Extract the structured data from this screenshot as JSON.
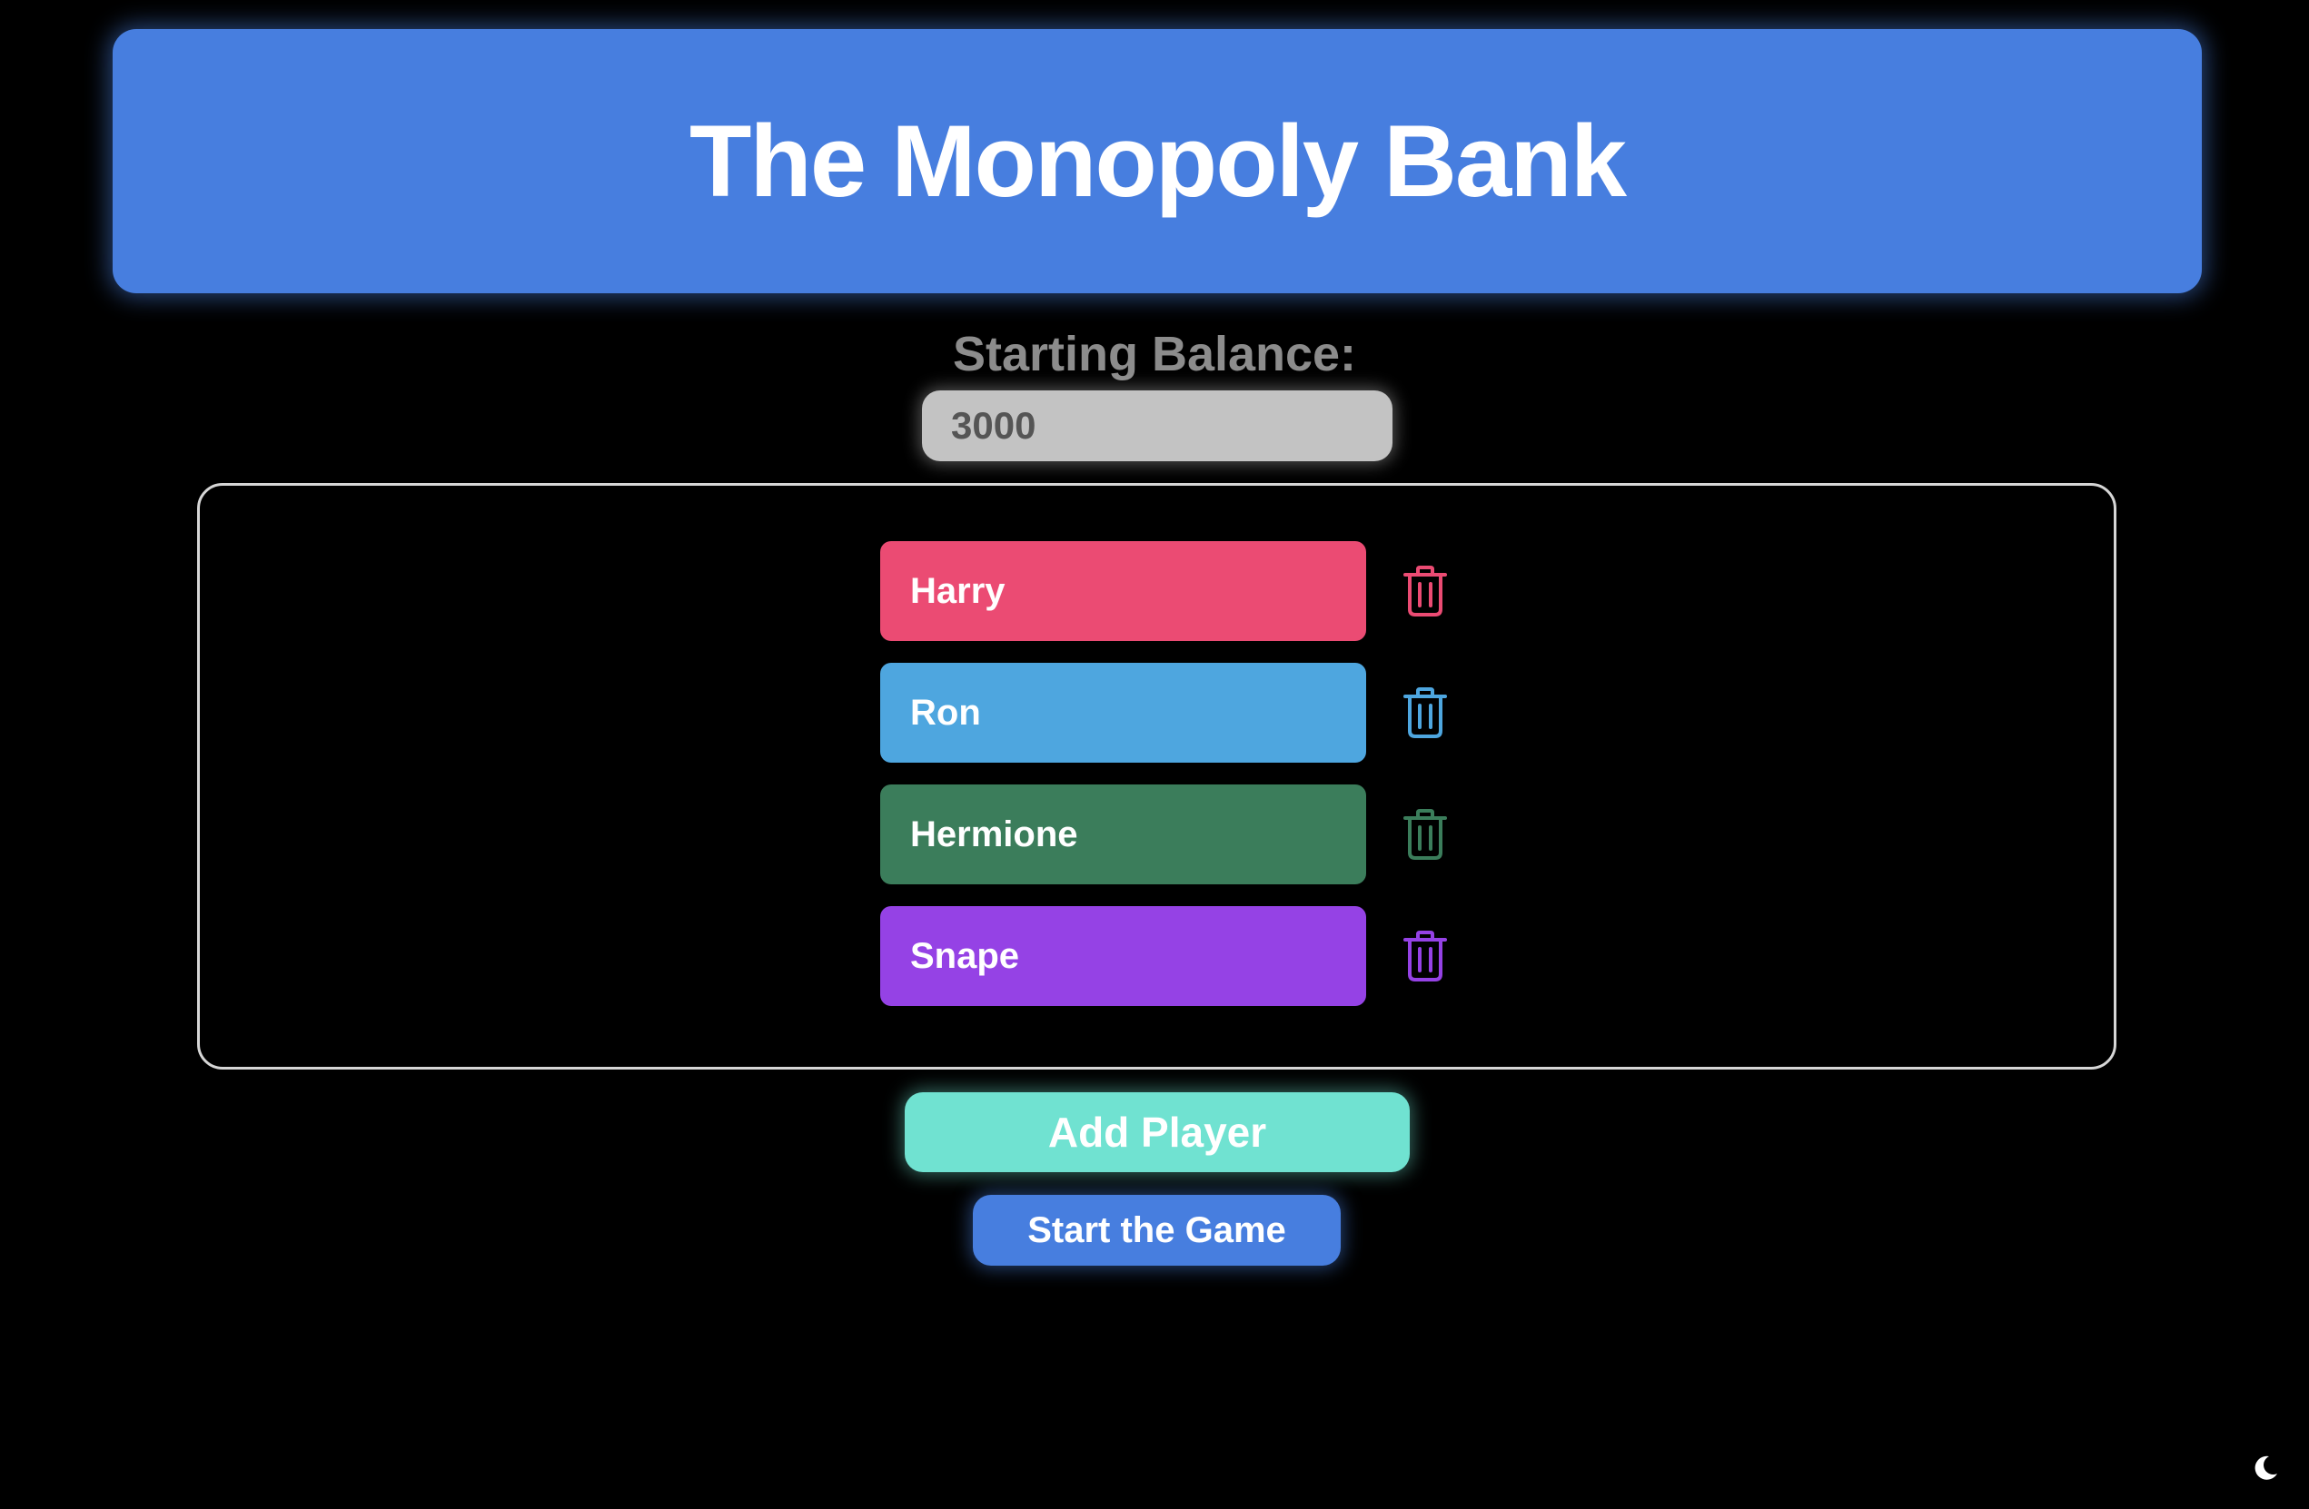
{
  "header": {
    "title": "The Monopoly Bank",
    "color": "#477edf"
  },
  "balance": {
    "label": "Starting Balance:",
    "value": "3000"
  },
  "players": [
    {
      "name": "Harry",
      "color": "#eb4b73",
      "delete_icon": "trash-icon"
    },
    {
      "name": "Ron",
      "color": "#4ea6df",
      "delete_icon": "trash-icon"
    },
    {
      "name": "Hermione",
      "color": "#3b7d5b",
      "delete_icon": "trash-icon"
    },
    {
      "name": "Snape",
      "color": "#9542e5",
      "delete_icon": "trash-icon"
    }
  ],
  "actions": {
    "add_player_label": "Add Player",
    "add_player_color": "#70e2d1",
    "start_game_label": "Start the Game",
    "start_game_color": "#477edf"
  },
  "theme_toggle": {
    "icon": "moon-icon"
  }
}
